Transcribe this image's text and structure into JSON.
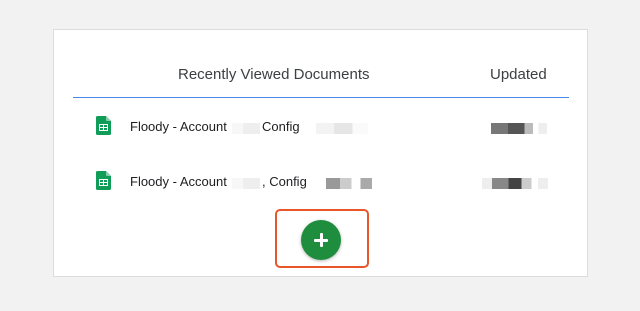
{
  "table": {
    "header": {
      "title_column": "Recently Viewed Documents",
      "updated_column": "Updated"
    },
    "rows": [
      {
        "name_part1": "Floody - Account",
        "name_part2": "Config",
        "icon": "google-sheets-icon"
      },
      {
        "name_part1": "Floody - Account",
        "name_part2": ", Config",
        "icon": "google-sheets-icon"
      }
    ]
  },
  "actions": {
    "add_button_icon": "plus-icon"
  },
  "colors": {
    "accent_divider": "#4a86e8",
    "add_button": "#1e8e3e",
    "highlight": "#e8562a",
    "sheets_green": "#0f9d58"
  }
}
